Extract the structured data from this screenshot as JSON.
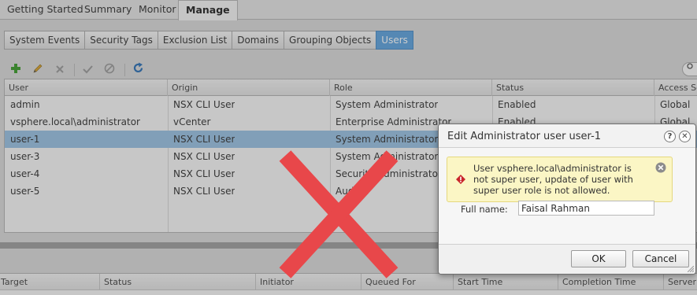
{
  "top_tabs": [
    "Getting Started",
    "Summary",
    "Monitor",
    "Manage"
  ],
  "sub_tabs": [
    "System Events",
    "Security Tags",
    "Exclusion List",
    "Domains",
    "Grouping Objects",
    "Users"
  ],
  "toolbar": {
    "icons": [
      "add-icon",
      "edit-icon",
      "delete-icon",
      "enable-icon",
      "disable-icon",
      "refresh-icon"
    ]
  },
  "users_table": {
    "columns": [
      "User",
      "Origin",
      "Role",
      "Status",
      "Access Scope"
    ],
    "rows": [
      {
        "user": "admin",
        "origin": "NSX CLI User",
        "role": "System Administrator",
        "status": "Enabled",
        "scope": "Global"
      },
      {
        "user": "vsphere.local\\administrator",
        "origin": "vCenter",
        "role": "Enterprise Administrator",
        "status": "Enabled",
        "scope": "Global"
      },
      {
        "user": "user-1",
        "origin": "NSX CLI User",
        "role": "System Administrator",
        "status": "",
        "scope": ""
      },
      {
        "user": "user-3",
        "origin": "NSX CLI User",
        "role": "System Administrator",
        "status": "",
        "scope": ""
      },
      {
        "user": "user-4",
        "origin": "NSX CLI User",
        "role": "Security Administrator",
        "status": "",
        "scope": ""
      },
      {
        "user": "user-5",
        "origin": "NSX CLI User",
        "role": "Auditor",
        "status": "",
        "scope": ""
      }
    ]
  },
  "tasks_table": {
    "columns": [
      "Target",
      "Status",
      "Initiator",
      "Queued For",
      "Start Time",
      "Completion Time",
      "Server"
    ]
  },
  "dialog": {
    "title": "Edit Administrator user user-1",
    "error_message": "User vsphere.local\\administrator is not super user, update of user with super user role is not allowed.",
    "full_name_label": "Full name:",
    "full_name_value": "Faisal Rahman",
    "ok_label": "OK",
    "cancel_label": "Cancel"
  },
  "colors": {
    "selection": "#99c1e3",
    "active_subtab": "#5ea3dd",
    "alert_bg": "#fbf6c5",
    "big_x": "#e8474a"
  }
}
